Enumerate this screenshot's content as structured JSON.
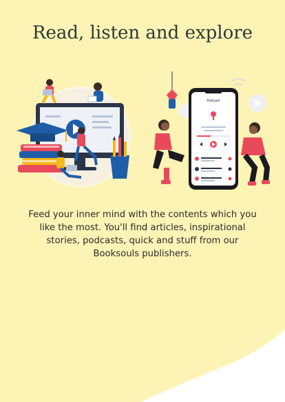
{
  "onboarding": {
    "title": "Read, listen and explore",
    "body": "Feed your inner mind with the contents which you like the most. You'll find articles, inspirational stories, podcasts, quick and stuff from our Booksouls publishers.",
    "phone_header": "Podcast"
  },
  "colors": {
    "background": "#fdf3b5",
    "lower_area": "#ffffff",
    "accent_red": "#e94a5b",
    "accent_blue": "#1e5ea8",
    "accent_yellow": "#f6b81c"
  },
  "illustrations": {
    "left": "online-learning-illustration",
    "right": "podcast-listening-illustration"
  }
}
